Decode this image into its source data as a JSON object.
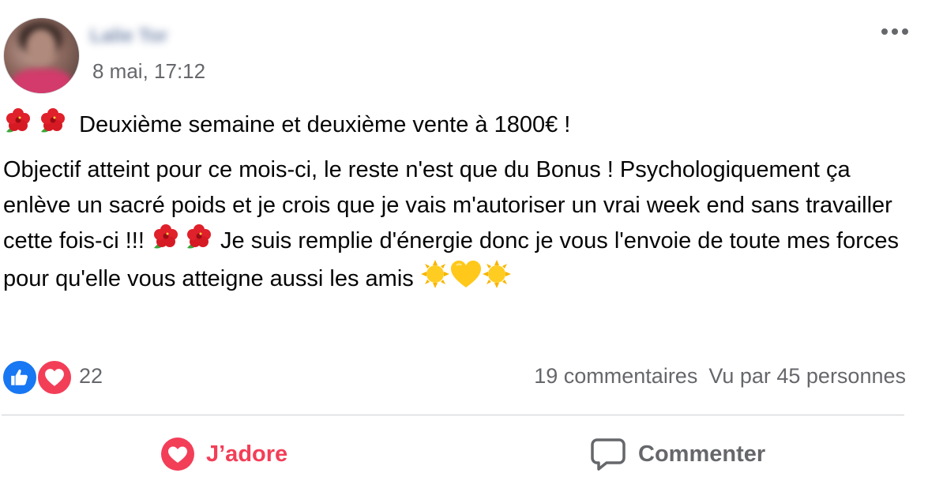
{
  "post": {
    "author_name": "Lalie Tor",
    "timestamp": "8 mai, 17:12",
    "text": {
      "line1": "Deuxième semaine et deuxième vente à 1800€ !",
      "para2_a": "Objectif atteint pour ce mois-ci, le reste n'est que du Bonus ! Psychologiquement ça enlève un sacré poids et je crois que je vais m'autoriser un vrai week end sans travailler cette fois-ci !!! ",
      "para2_b": " Je suis remplie d'énergie donc je vous l'envoie de toute mes forces pour qu'elle vous atteigne aussi les amis "
    },
    "emojis": {
      "hibiscus": "hibiscus-icon",
      "sun": "sun-icon",
      "yellow_heart": "yellow-heart-icon"
    }
  },
  "reactions": {
    "count": "22",
    "types": [
      "like-icon",
      "love-icon"
    ]
  },
  "stats": {
    "comments": "19 commentaires",
    "views": "Vu par 45 personnes"
  },
  "actions": {
    "love_label": "J’adore",
    "comment_label": "Commenter"
  },
  "colors": {
    "love_red": "#f33e58",
    "like_blue": "#1877f2",
    "secondary_text": "#65676b",
    "divider": "#ced0d4"
  }
}
